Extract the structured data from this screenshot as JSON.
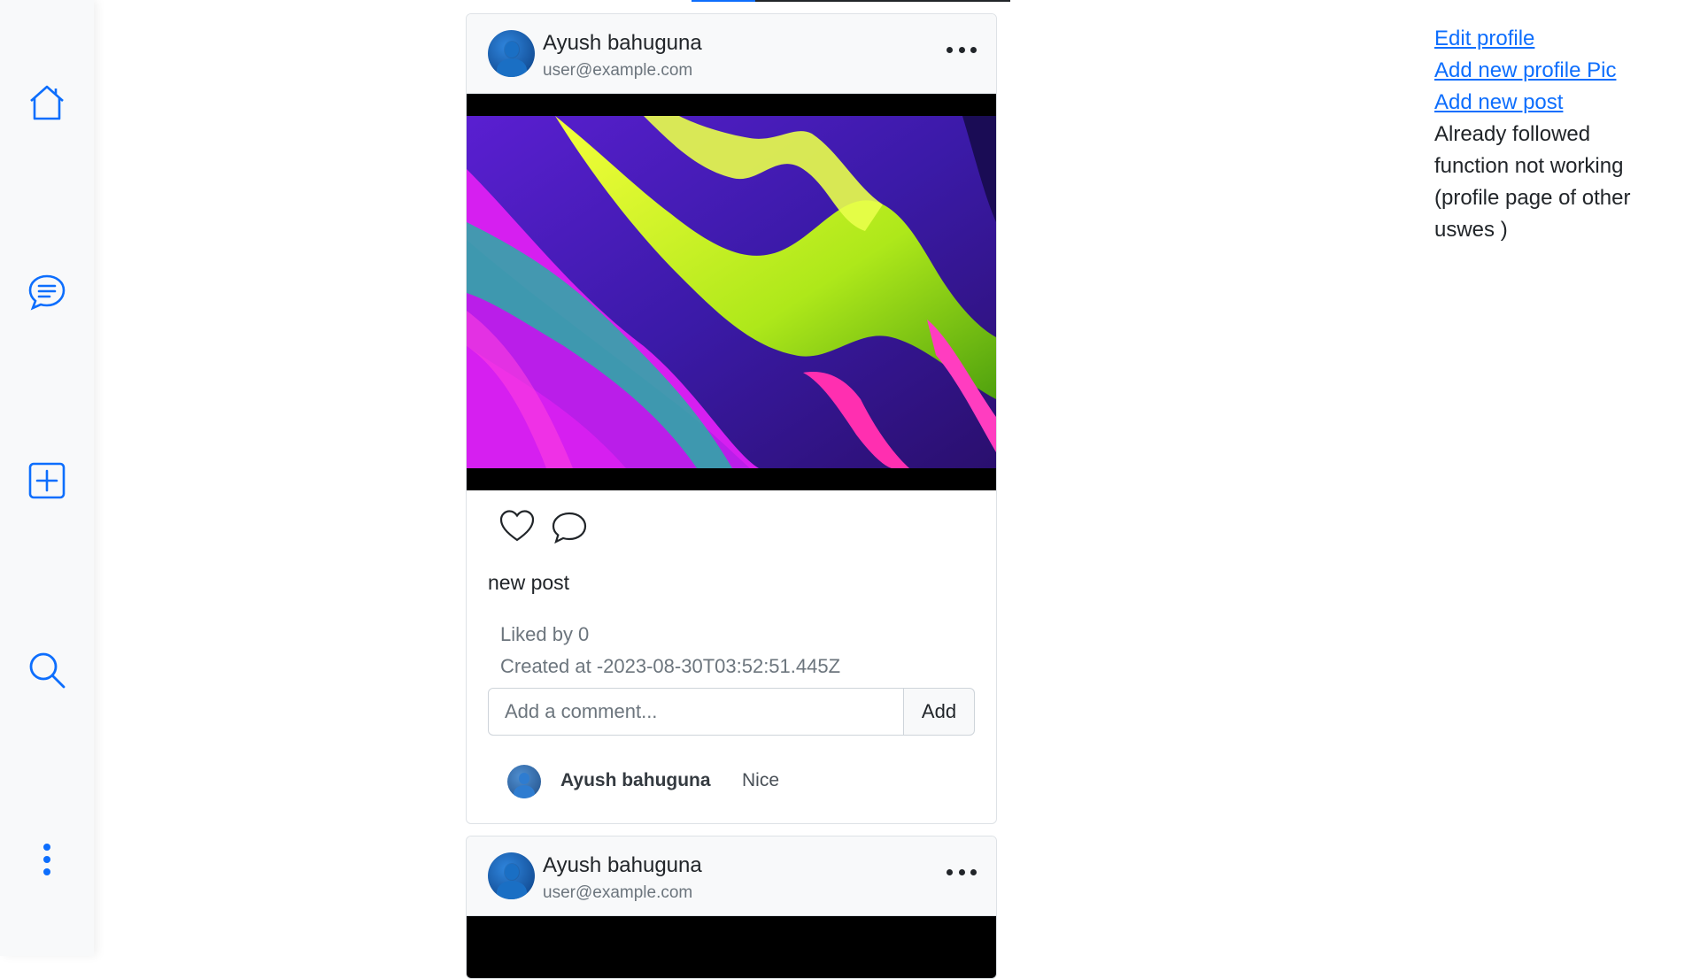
{
  "sidebar": {
    "items": [
      {
        "icon": "home-icon"
      },
      {
        "icon": "chat-icon"
      },
      {
        "icon": "plus-square-icon"
      },
      {
        "icon": "search-icon"
      },
      {
        "icon": "more-vertical-icon"
      }
    ]
  },
  "progress": {
    "value_percent": 20
  },
  "posts": [
    {
      "author": "Ayush bahuguna",
      "email": "user@example.com",
      "caption": "new post",
      "likes": "Liked by 0",
      "created": "Created at -2023-08-30T03:52:51.445Z",
      "comment_placeholder": "Add a comment...",
      "add_label": "Add",
      "comments": [
        {
          "author": "Ayush bahuguna",
          "text": "Nice"
        }
      ]
    },
    {
      "author": "Ayush bahuguna",
      "email": "user@example.com"
    }
  ],
  "side_links": {
    "edit_profile": "Edit profile",
    "add_profile_pic": "Add new profile Pic",
    "add_post": "Add new post",
    "note": "Already followed function not working (profile page of other uswes )"
  },
  "colors": {
    "accent": "#0d6efd",
    "sidebar_bg": "#f8f9fa",
    "text": "#212529",
    "muted": "#6c757d"
  }
}
